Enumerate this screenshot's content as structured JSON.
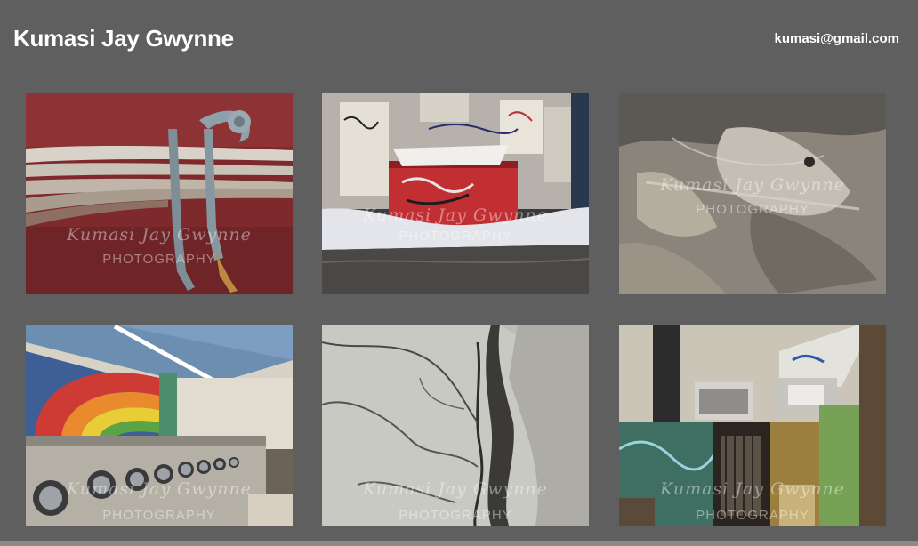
{
  "header": {
    "title": "Kumasi Jay Gwynne",
    "email": "kumasi@gmail.com"
  },
  "watermark": {
    "name": "Kumasi Jay Gwynne",
    "subtitle": "PHOTOGRAPHY"
  },
  "gallery": {
    "photos": [
      {
        "subject": "cables-bolt-on-red-wall"
      },
      {
        "subject": "red-dumpster-graffiti-snow"
      },
      {
        "subject": "stained-concrete-wall"
      },
      {
        "subject": "laundromat-rainbow-mural"
      },
      {
        "subject": "cracked-white-plaster"
      },
      {
        "subject": "graffiti-alley-doorway"
      }
    ]
  },
  "colors": {
    "background": "#5f5f5f",
    "text": "#ffffff"
  }
}
